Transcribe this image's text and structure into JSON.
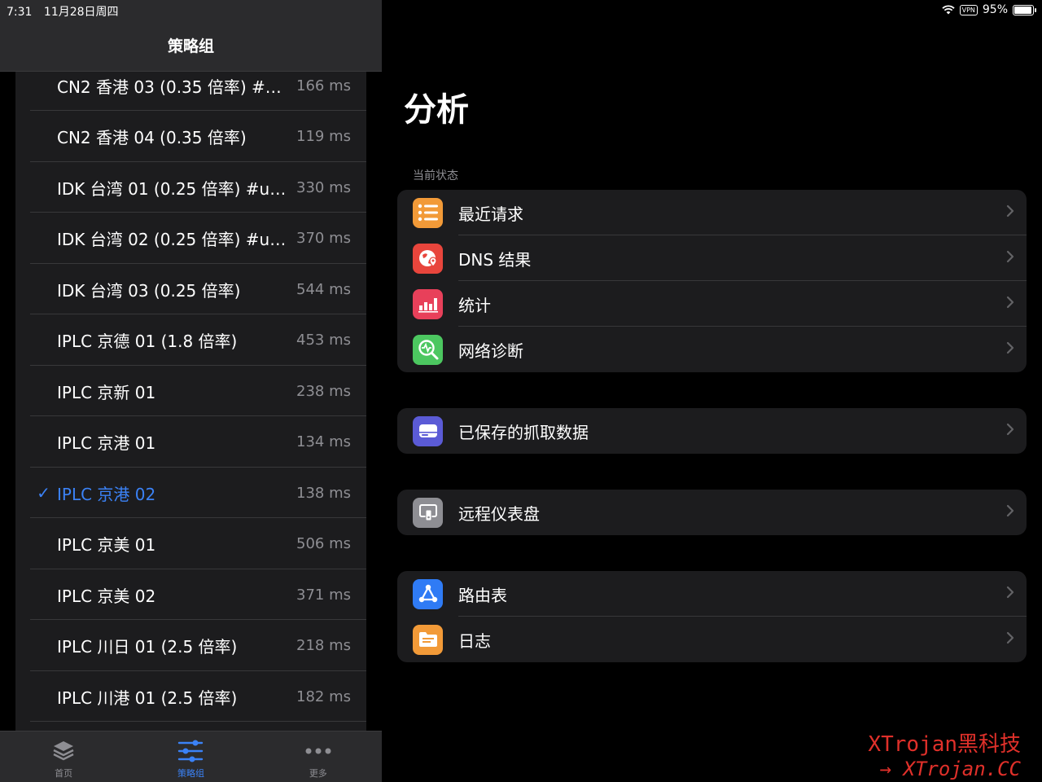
{
  "status": {
    "time": "7:31",
    "date": "11月28日周四",
    "vpn": "VPN",
    "battery": "95%",
    "battery_level": 0.95
  },
  "left": {
    "title": "策略组",
    "items": [
      {
        "name": "CN2 香港 03 (0.35 倍率) #u...",
        "latency": "166 ms",
        "selected": false
      },
      {
        "name": "CN2 香港 04 (0.35 倍率)",
        "latency": "119 ms",
        "selected": false
      },
      {
        "name": "IDK 台湾 01 (0.25 倍率) #un...",
        "latency": "330 ms",
        "selected": false
      },
      {
        "name": "IDK 台湾 02 (0.25 倍率) #un...",
        "latency": "370 ms",
        "selected": false
      },
      {
        "name": "IDK 台湾 03 (0.25 倍率)",
        "latency": "544 ms",
        "selected": false
      },
      {
        "name": "IPLC 京德 01 (1.8 倍率)",
        "latency": "453 ms",
        "selected": false
      },
      {
        "name": "IPLC 京新 01",
        "latency": "238 ms",
        "selected": false
      },
      {
        "name": "IPLC 京港 01",
        "latency": "134 ms",
        "selected": false
      },
      {
        "name": "IPLC 京港 02",
        "latency": "138 ms",
        "selected": true
      },
      {
        "name": "IPLC 京美 01",
        "latency": "506 ms",
        "selected": false
      },
      {
        "name": "IPLC 京美 02",
        "latency": "371 ms",
        "selected": false
      },
      {
        "name": "IPLC 川日 01 (2.5 倍率)",
        "latency": "218 ms",
        "selected": false
      },
      {
        "name": "IPLC 川港 01 (2.5 倍率)",
        "latency": "182 ms",
        "selected": false
      }
    ],
    "tabs": [
      {
        "label": "首页",
        "icon": "layers-icon",
        "active": false
      },
      {
        "label": "策略组",
        "icon": "sliders-icon",
        "active": true
      },
      {
        "label": "更多",
        "icon": "more-icon",
        "active": false
      }
    ]
  },
  "right": {
    "title": "分析",
    "section_label": "当前状态",
    "groups": [
      {
        "rows": [
          {
            "label": "最近请求",
            "icon": "list-icon",
            "color": "#f29a38"
          },
          {
            "label": "DNS 结果",
            "icon": "globe-pin-icon",
            "color": "#e8453c"
          },
          {
            "label": "统计",
            "icon": "bar-chart-icon",
            "color": "#e8405a"
          },
          {
            "label": "网络诊断",
            "icon": "diagnose-icon",
            "color": "#4cc760"
          }
        ]
      },
      {
        "rows": [
          {
            "label": "已保存的抓取数据",
            "icon": "drive-icon",
            "color": "#5b5bd6"
          }
        ]
      },
      {
        "rows": [
          {
            "label": "远程仪表盘",
            "icon": "remote-icon",
            "color": "#8e8e93"
          }
        ]
      },
      {
        "rows": [
          {
            "label": "路由表",
            "icon": "route-icon",
            "color": "#2f7bf5"
          },
          {
            "label": "日志",
            "icon": "folder-icon",
            "color": "#f29a38"
          }
        ]
      }
    ]
  },
  "watermark": {
    "line1": "XTrojan黑科技",
    "line2": "→ XTrojan.CC"
  }
}
